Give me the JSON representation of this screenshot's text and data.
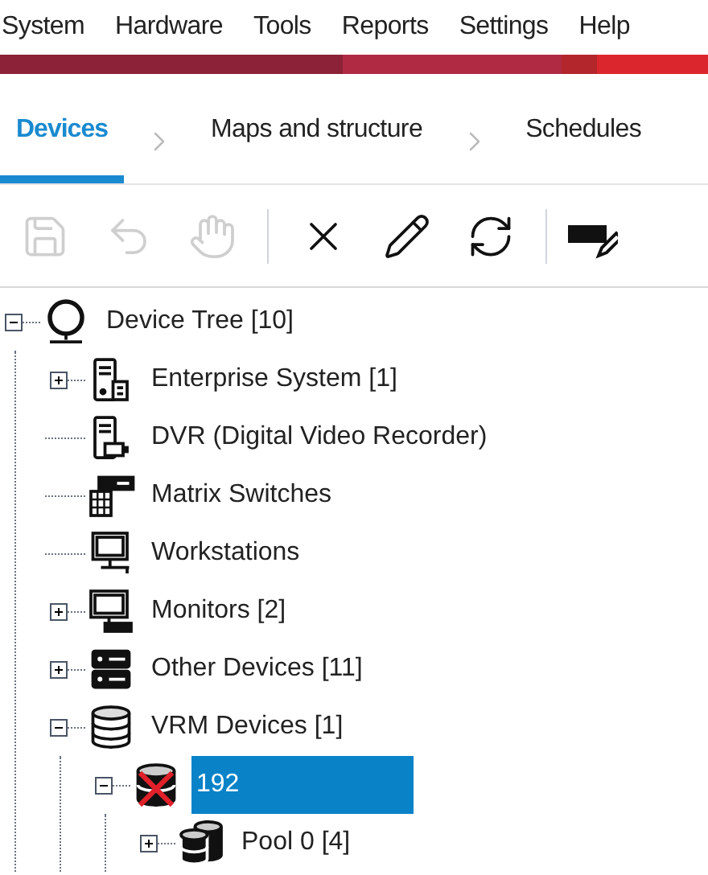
{
  "menu": [
    "System",
    "Hardware",
    "Tools",
    "Reports",
    "Settings",
    "Help"
  ],
  "tabs": [
    {
      "label": "Devices",
      "selected": true
    },
    {
      "label": "Maps and structure",
      "selected": false
    },
    {
      "label": "Schedules",
      "selected": false
    }
  ],
  "toolbar": [
    {
      "kind": "save",
      "disabled": true
    },
    {
      "kind": "undo",
      "disabled": true
    },
    {
      "kind": "hand",
      "disabled": true
    },
    {
      "kind": "separator"
    },
    {
      "kind": "delete",
      "disabled": false
    },
    {
      "kind": "edit",
      "disabled": false
    },
    {
      "kind": "refresh",
      "disabled": false
    },
    {
      "kind": "separator"
    },
    {
      "kind": "tag-edit",
      "disabled": false
    }
  ],
  "tree": [
    {
      "label": "Device Tree [10]",
      "kind": "root",
      "expanded": true,
      "selected": false,
      "children": [
        {
          "label": "Enterprise System [1]",
          "kind": "enterprise",
          "expanded": false,
          "selected": false
        },
        {
          "label": "DVR (Digital Video Recorder)",
          "kind": "dvr",
          "selected": false
        },
        {
          "label": "Matrix Switches",
          "kind": "matrix",
          "selected": false
        },
        {
          "label": "Workstations",
          "kind": "workstation",
          "selected": false
        },
        {
          "label": "Monitors [2]",
          "kind": "monitor",
          "expanded": false,
          "selected": false
        },
        {
          "label": "Other Devices [11]",
          "kind": "other",
          "expanded": false,
          "selected": false
        },
        {
          "label": "VRM Devices [1]",
          "kind": "vrm",
          "expanded": true,
          "selected": false,
          "children": [
            {
              "label": "192",
              "kind": "vrm-error",
              "expanded": true,
              "selected": true,
              "children": [
                {
                  "label": "Pool 0 [4]",
                  "kind": "pool",
                  "expanded": false,
                  "selected": false
                }
              ]
            }
          ]
        }
      ]
    }
  ]
}
